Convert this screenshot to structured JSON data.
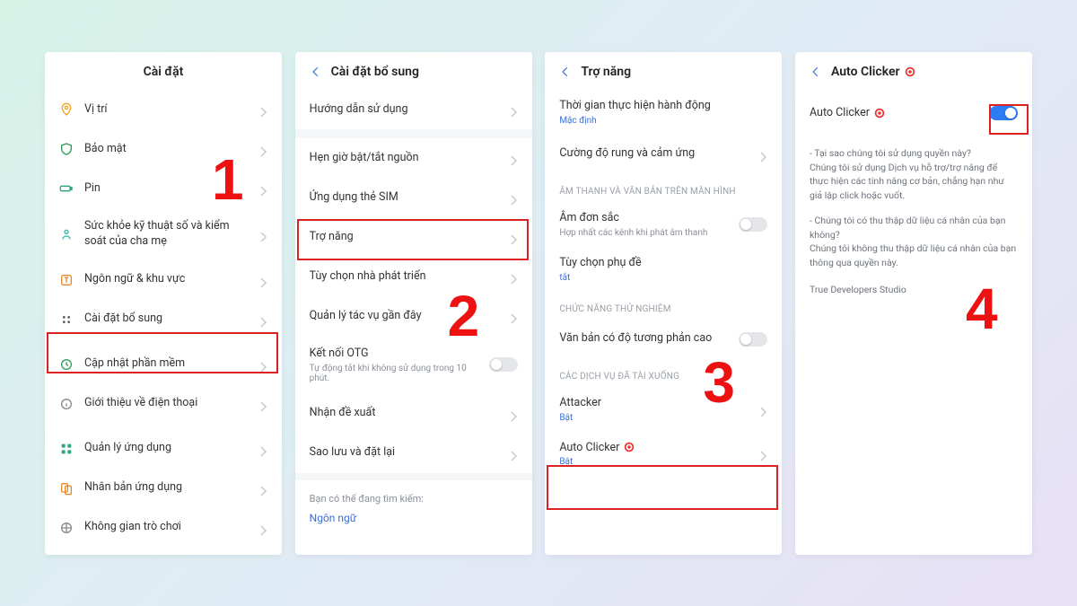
{
  "steps": {
    "s1": "1",
    "s2": "2",
    "s3": "3",
    "s4": "4"
  },
  "panel1": {
    "title": "Cài đặt",
    "items": [
      {
        "label": "Vị trí"
      },
      {
        "label": "Bảo mật"
      },
      {
        "label": "Pin"
      },
      {
        "label": "Sức khỏe kỹ thuật số và kiểm soát của cha mẹ"
      },
      {
        "label": "Ngôn ngữ & khu vực"
      },
      {
        "label": "Cài đặt bổ sung"
      },
      {
        "label": "Cập nhật phần mềm"
      },
      {
        "label": "Giới thiệu về điện thoại"
      },
      {
        "label": "Quản lý ứng dụng"
      },
      {
        "label": "Nhân bản ứng dụng"
      },
      {
        "label": "Không gian trò chơi"
      }
    ]
  },
  "panel2": {
    "title": "Cài đặt bổ sung",
    "items": [
      {
        "label": "Hướng dẫn sử dụng"
      },
      {
        "label": "Hẹn giờ bật/tắt nguồn"
      },
      {
        "label": "Ứng dụng thẻ SIM"
      },
      {
        "label": "Trợ năng"
      },
      {
        "label": "Tùy chọn nhà phát triển"
      },
      {
        "label": "Quản lý tác vụ gần đây"
      },
      {
        "label": "Kết nối OTG",
        "sub": "Tự động tắt khi không sử dụng trong 10 phút."
      },
      {
        "label": "Nhận đề xuất"
      },
      {
        "label": "Sao lưu và đặt lại"
      }
    ],
    "search_note": "Bạn có thể đang tìm kiếm:",
    "search_link": "Ngôn ngữ"
  },
  "panel3": {
    "title": "Trợ năng",
    "group0": [
      {
        "label": "Thời gian thực hiện hành động",
        "sub": "Mặc định"
      },
      {
        "label": "Cường độ rung và cảm ứng"
      }
    ],
    "sect1": "ÂM THANH VÀ VĂN BẢN TRÊN MÀN HÌNH",
    "group1": [
      {
        "label": "Âm đơn sắc",
        "sub": "Hợp nhất các kênh khi phát âm thanh"
      },
      {
        "label": "Tùy chọn phụ đề",
        "sub": "tắt"
      }
    ],
    "sect2": "CHỨC NĂNG THỬ NGHIỆM",
    "group2": [
      {
        "label": "Văn bản có độ tương phản cao"
      }
    ],
    "sect3": "CÁC DỊCH VỤ ĐÃ TÀI XUỐNG",
    "group3": [
      {
        "label": "Attacker",
        "sub": "Bật"
      },
      {
        "label": "Auto Clicker",
        "sub": "Bật"
      }
    ]
  },
  "panel4": {
    "title": "Auto Clicker",
    "toggle_label": "Auto Clicker",
    "info1": "- Tại sao chúng tôi sử dụng quyền này?\nChúng tôi sử dụng Dịch vụ hỗ trợ/trợ năng để thực hiện các tính năng cơ bản, chẳng hạn như giả lập click hoặc vuốt.",
    "info2": "- Chúng tôi có thu thập dữ liệu cá nhân của bạn không?\nChúng tôi không thu thập dữ liệu cá nhân của bạn thông qua quyền này.",
    "developer": "True Developers Studio"
  }
}
